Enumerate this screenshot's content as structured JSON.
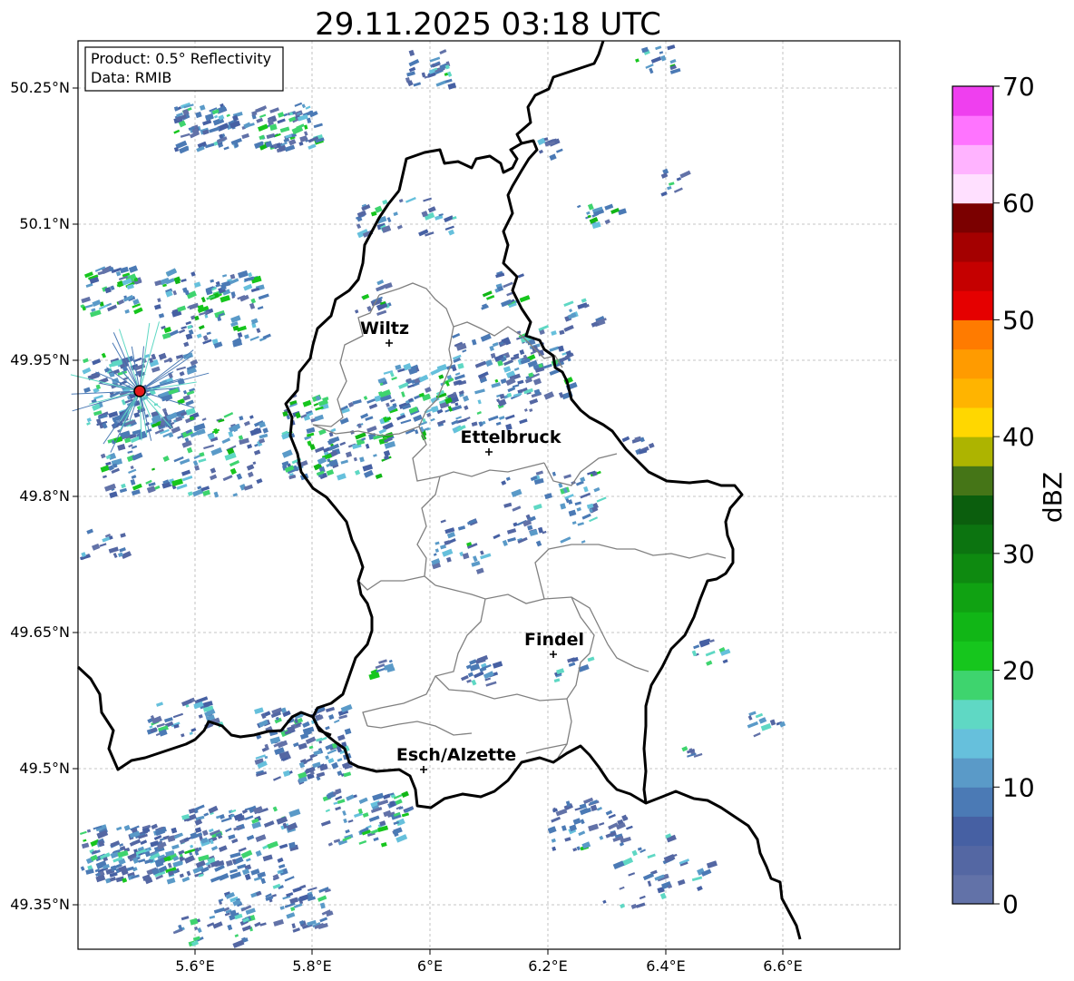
{
  "title": "29.11.2025 03:18 UTC",
  "info": {
    "product": "Product: 0.5° Reflectivity",
    "data": "Data: RMIB"
  },
  "axes": {
    "lat_labels": [
      "50.25°N",
      "50.1°N",
      "49.95°N",
      "49.8°N",
      "49.65°N",
      "49.5°N",
      "49.35°N"
    ],
    "lon_labels": [
      "5.6°E",
      "5.8°E",
      "6°E",
      "6.2°E",
      "6.4°E",
      "6.6°E"
    ]
  },
  "colorbar": {
    "label": "dBZ",
    "ticks": [
      "0",
      "10",
      "20",
      "30",
      "40",
      "50",
      "60",
      "70"
    ],
    "colors": [
      "#6272a8",
      "#5467a3",
      "#4660a3",
      "#4b7ab5",
      "#5a9ac8",
      "#66c0dc",
      "#5fd8c4",
      "#3ed46e",
      "#16c61d",
      "#11b616",
      "#10a212",
      "#0e8a10",
      "#0c7410",
      "#0b5e0d",
      "#457517",
      "#adb400",
      "#ffd700",
      "#ffb400",
      "#ff9b00",
      "#ff7b00",
      "#e50000",
      "#c50000",
      "#a40000",
      "#7b0000",
      "#ffe0ff",
      "#ffb3ff",
      "#ff74ff",
      "#ef3fef"
    ]
  },
  "cities": [
    {
      "name": "Wiltz"
    },
    {
      "name": "Ettelbruck"
    },
    {
      "name": "Findel"
    },
    {
      "name": "Esch/Alzette"
    }
  ],
  "radar_site_color": "#e41a1c"
}
